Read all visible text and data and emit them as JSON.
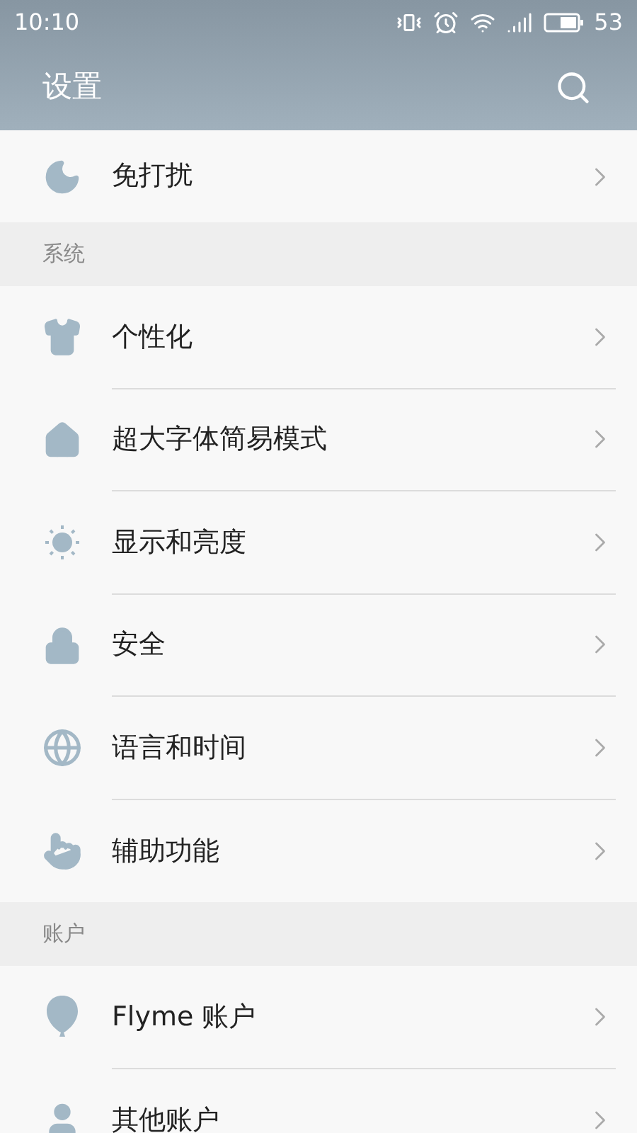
{
  "status_bar": {
    "time": "10:10",
    "battery": "53"
  },
  "header": {
    "title": "设置"
  },
  "sections": [
    {
      "items": [
        {
          "label": "免打扰",
          "kind": "moon"
        }
      ]
    },
    {
      "title": "系统",
      "items": [
        {
          "label": "个性化",
          "kind": "shirt"
        },
        {
          "label": "超大字体简易模式",
          "kind": "house"
        },
        {
          "label": "显示和亮度",
          "kind": "sun"
        },
        {
          "label": "安全",
          "kind": "lock"
        },
        {
          "label": "语言和时间",
          "kind": "globe"
        },
        {
          "label": "辅助功能",
          "kind": "hand"
        }
      ]
    },
    {
      "title": "账户",
      "items": [
        {
          "label": "Flyme 账户",
          "kind": "balloon"
        },
        {
          "label": "其他账户",
          "kind": "user"
        }
      ]
    }
  ]
}
